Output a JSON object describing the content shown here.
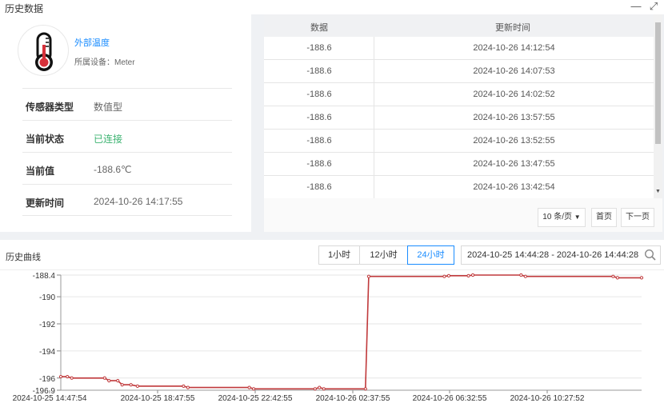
{
  "window": {
    "title": "历史数据",
    "minimize_glyph": "—",
    "expand_glyph": "⤢"
  },
  "sensor": {
    "name": "外部温度",
    "device": "所属设备：Meter",
    "icon": "thermometer-icon",
    "fields": [
      {
        "label": "传感器类型",
        "value": "数值型"
      },
      {
        "label": "当前状态",
        "value": "已连接"
      },
      {
        "label": "当前值",
        "value": "-188.6℃"
      },
      {
        "label": "更新时间",
        "value": "2024-10-26 14:17:55"
      }
    ],
    "status_color": "#3cb371"
  },
  "table": {
    "headers": [
      "数据",
      "更新时间"
    ],
    "rows": [
      {
        "value": "-188.6",
        "time": "2024-10-26 14:12:54"
      },
      {
        "value": "-188.6",
        "time": "2024-10-26 14:07:53"
      },
      {
        "value": "-188.6",
        "time": "2024-10-26 14:02:52"
      },
      {
        "value": "-188.6",
        "time": "2024-10-26 13:57:55"
      },
      {
        "value": "-188.6",
        "time": "2024-10-26 13:52:55"
      },
      {
        "value": "-188.6",
        "time": "2024-10-26 13:47:55"
      },
      {
        "value": "-188.6",
        "time": "2024-10-26 13:42:54"
      }
    ]
  },
  "pager": {
    "page_size": "10 条/页",
    "first": "首页",
    "next": "下一页"
  },
  "history": {
    "title": "历史曲线",
    "ranges": [
      "1小时",
      "12小时",
      "24小时"
    ],
    "active_range": "24小时",
    "date_range": "2024-10-25 14:44:28 - 2024-10-26 14:44:28",
    "accent": "#1a8cff"
  },
  "chart_data": {
    "type": "line",
    "line_color": "#c0393b",
    "x_tick_labels": [
      "2024-10-25 14:47:54",
      "2024-10-25 18:47:55",
      "2024-10-25 22:42:55",
      "2024-10-26 02:37:55",
      "2024-10-26 06:32:55",
      "2024-10-26 10:27:52"
    ],
    "y_ticks": [
      -188.4,
      -190,
      -192,
      -194,
      -196,
      -196.9
    ],
    "ylim": [
      -196.9,
      -188.4
    ],
    "series": [
      {
        "points": [
          [
            0,
            -195.9
          ],
          [
            0.3,
            -195.9
          ],
          [
            0.5,
            -196.0
          ],
          [
            2.0,
            -196.0
          ],
          [
            2.2,
            -196.2
          ],
          [
            2.6,
            -196.2
          ],
          [
            2.8,
            -196.5
          ],
          [
            3.2,
            -196.5
          ],
          [
            3.5,
            -196.6
          ],
          [
            5.6,
            -196.6
          ],
          [
            5.8,
            -196.7
          ],
          [
            8.6,
            -196.7
          ],
          [
            8.8,
            -196.8
          ],
          [
            11.6,
            -196.8
          ],
          [
            11.8,
            -196.7
          ],
          [
            12.0,
            -196.8
          ],
          [
            13.9,
            -196.8
          ],
          [
            14.05,
            -188.5
          ],
          [
            17.5,
            -188.5
          ],
          [
            17.7,
            -188.45
          ],
          [
            18.6,
            -188.45
          ],
          [
            18.8,
            -188.4
          ],
          [
            21.0,
            -188.4
          ],
          [
            21.2,
            -188.5
          ],
          [
            25.2,
            -188.5
          ],
          [
            25.4,
            -188.6
          ],
          [
            26.5,
            -188.6
          ]
        ]
      }
    ]
  }
}
